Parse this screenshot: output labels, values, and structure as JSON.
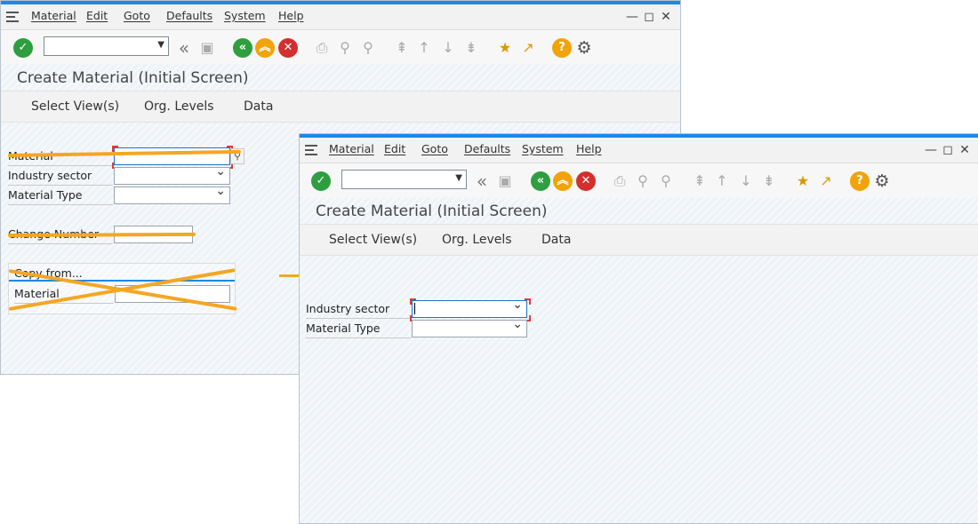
{
  "menu": {
    "material": "Material",
    "edit": "Edit",
    "goto": "Goto",
    "defaults": "Defaults",
    "system": "System",
    "help": "Help"
  },
  "window_controls": {
    "minimize": "—",
    "maximize": "◻",
    "close": "✕"
  },
  "toolbar": {
    "enter_icon": "checkmark-icon",
    "command_field_value": "",
    "back_icon": "back-icon",
    "exit_icon": "exit-icon",
    "cancel_icon": "cancel-icon",
    "help_icon": "help-icon",
    "settings_icon": "gear-icon"
  },
  "colors": {
    "accent_blue": "#1e88e5",
    "green": "#2e9e3f",
    "orange": "#f0a30a",
    "red": "#d32f2f",
    "strike_orange": "#f5a623"
  },
  "screen": {
    "title": "Create Material (Initial Screen)",
    "app_buttons": [
      "Select View(s)",
      "Org. Levels",
      "Data"
    ]
  },
  "before": {
    "fields": {
      "material": "Material",
      "industry_sector": "Industry sector",
      "material_type": "Material Type",
      "change_number": "Change Number"
    },
    "copy_from": {
      "title": "Copy from...",
      "material": "Material"
    }
  },
  "after": {
    "fields": {
      "industry_sector": "Industry sector",
      "material_type": "Material Type"
    }
  }
}
